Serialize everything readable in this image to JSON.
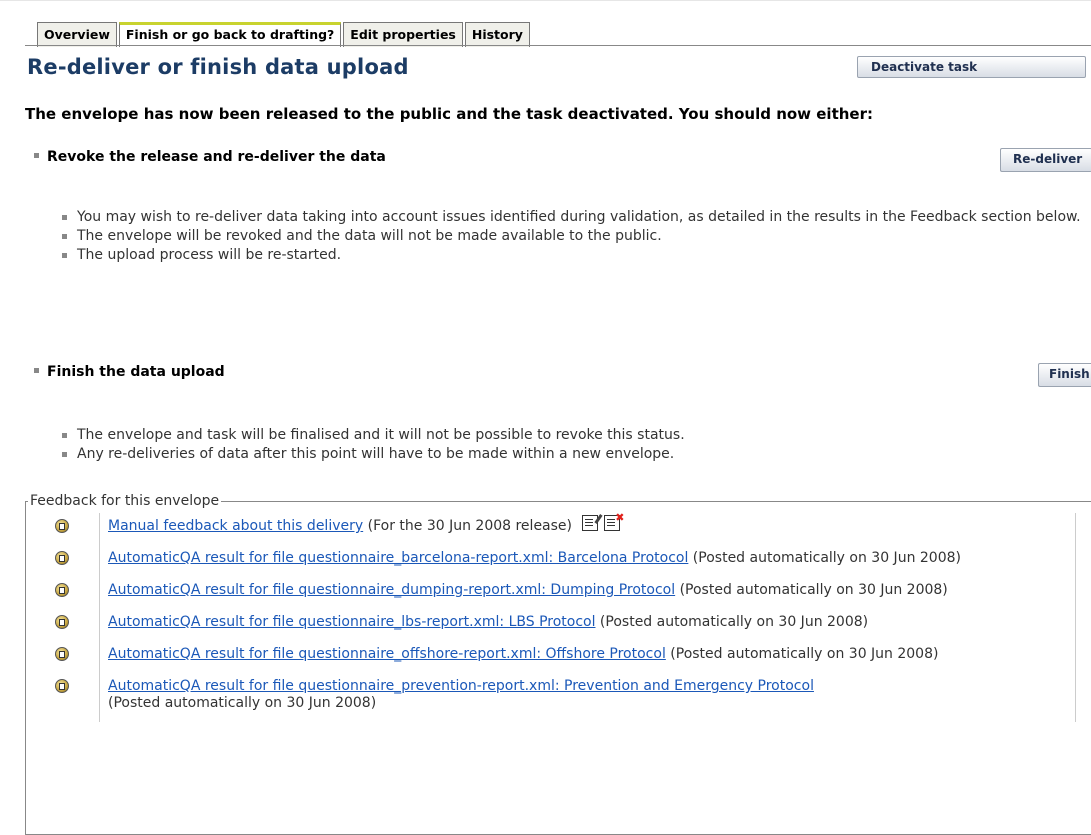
{
  "tabs": [
    "Overview",
    "Finish or go back to drafting?",
    "Edit properties",
    "History"
  ],
  "page_title": "Re-deliver or finish data upload",
  "deactivate_label": "Deactivate task",
  "intro_text": "The envelope has now been released to the public and the task deactivated. You should now either:",
  "section_redeliver": {
    "title": "Revoke the release and re-deliver the data",
    "button": "Re-deliver",
    "bullets": [
      "You may wish to re-deliver data taking into account issues identified during validation, as detailed in the results in the Feedback section below.",
      "The envelope will be revoked and the data will not be made available to the public.",
      "The upload process will be re-started."
    ]
  },
  "section_finish": {
    "title": "Finish the data upload",
    "button": "Finish",
    "bullets": [
      "The envelope and task will be finalised and it will not be possible to revoke this status.",
      "Any re-deliveries of data after this point will have to be made within a new envelope."
    ]
  },
  "feedback": {
    "legend": "Feedback for this envelope",
    "items": [
      {
        "link": "Manual feedback about this delivery",
        "note": " (For the 30 Jun 2008 release)"
      },
      {
        "link": "AutomaticQA result for file questionnaire_barcelona-report.xml: Barcelona Protocol",
        "note": " (Posted automatically on 30 Jun 2008)"
      },
      {
        "link": "AutomaticQA result for file questionnaire_dumping-report.xml: Dumping Protocol",
        "note": " (Posted automatically on 30 Jun 2008)"
      },
      {
        "link": "AutomaticQA result for file questionnaire_lbs-report.xml: LBS Protocol",
        "note": " (Posted automatically on 30 Jun 2008)"
      },
      {
        "link": "AutomaticQA result for file questionnaire_offshore-report.xml: Offshore Protocol",
        "note": " (Posted automatically on 30 Jun 2008)"
      },
      {
        "link": "AutomaticQA result for file questionnaire_prevention-report.xml: Prevention and Emergency Protocol",
        "note": " (Posted automatically on 30 Jun 2008)"
      }
    ]
  }
}
